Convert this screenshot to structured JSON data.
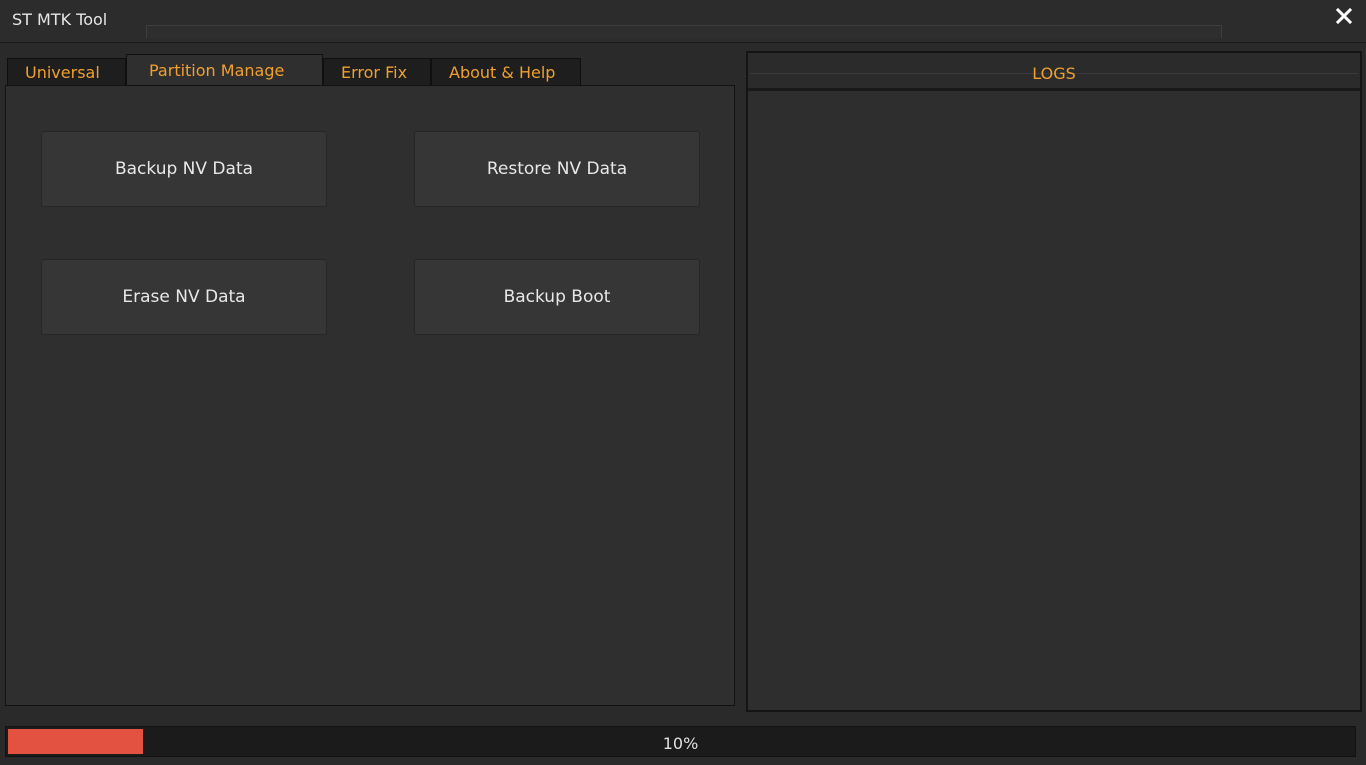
{
  "window": {
    "title": "ST MTK Tool",
    "close_icon": "close-icon"
  },
  "tabs": [
    {
      "label": "Universal",
      "active": false
    },
    {
      "label": "Partition Manage",
      "active": true
    },
    {
      "label": "Error Fix",
      "active": false
    },
    {
      "label": "About & Help",
      "active": false
    }
  ],
  "partition_manage": {
    "buttons": {
      "backup_nv": "Backup NV Data",
      "restore_nv": "Restore NV Data",
      "erase_nv": "Erase NV Data",
      "backup_boot": "Backup Boot"
    }
  },
  "logs": {
    "title": "LOGS"
  },
  "progress": {
    "value_percent": 10,
    "label": "10%"
  },
  "colors": {
    "accent_text": "#f0a030",
    "progress_fill": "#e35240",
    "background": "#2a2a2a"
  }
}
